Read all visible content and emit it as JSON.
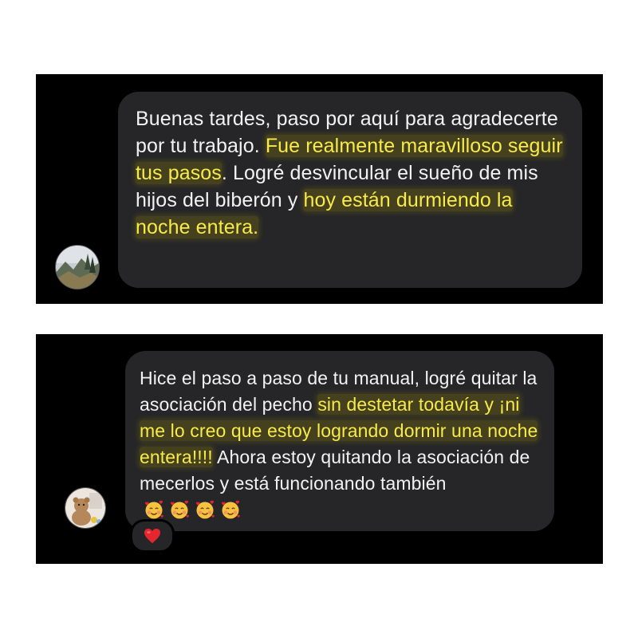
{
  "messages": [
    {
      "segments": [
        {
          "text": "Buenas tardes, paso por aquí para agradecerte por tu trabajo. ",
          "highlight": false
        },
        {
          "text": "Fue realmente maravilloso seguir tus pasos",
          "highlight": true
        },
        {
          "text": ". Logré desvincular el sueño de mis hijos del biberón y ",
          "highlight": false
        },
        {
          "text": "hoy están durmiendo la noche entera.",
          "highlight": true
        }
      ],
      "avatar": "mountain-landscape-avatar"
    },
    {
      "segments": [
        {
          "text": "Hice el paso a paso de tu manual, logré quitar la asociación del pecho ",
          "highlight": false
        },
        {
          "text": "sin destetar todavía y ¡ni me lo creo que estoy logrando dormir una noche entera!!!!",
          "highlight": true
        },
        {
          "text": " Ahora estoy quitando la asociación de mecerlos y está funcionando también",
          "highlight": false
        }
      ],
      "emojis": [
        "smiling-face-with-hearts",
        "smiling-face-with-hearts",
        "smiling-face-with-hearts",
        "smiling-face-with-hearts"
      ],
      "avatar": "teddy-bear-avatar",
      "reaction": "red-heart"
    }
  ],
  "colors": {
    "panel_bg": "#000000",
    "bubble_bg": "#262628",
    "text": "#f2f2f2",
    "highlight_text": "#f7ea4a"
  }
}
